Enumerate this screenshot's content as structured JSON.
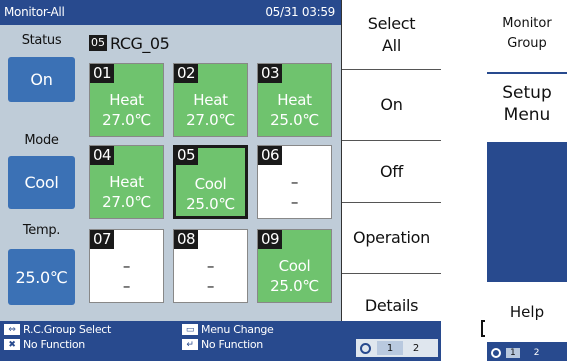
{
  "title_bar": {
    "left": "Monitor-All",
    "right": "05/31 03:59"
  },
  "left_column": {
    "status_label": "Status",
    "status_value": "On",
    "mode_label": "Mode",
    "mode_value": "Cool",
    "temp_label": "Temp.",
    "temp_value": "25.0℃"
  },
  "group": {
    "badge": "05",
    "name": "RCG_05"
  },
  "cells": [
    {
      "num": "01",
      "mode": "Heat",
      "temp": "27.0℃"
    },
    {
      "num": "02",
      "mode": "Heat",
      "temp": "27.0℃"
    },
    {
      "num": "03",
      "mode": "Heat",
      "temp": "25.0℃"
    },
    {
      "num": "04",
      "mode": "Heat",
      "temp": "27.0℃"
    },
    {
      "num": "05",
      "mode": "Cool",
      "temp": "25.0℃"
    },
    {
      "num": "06",
      "mode": "–",
      "temp": "–"
    },
    {
      "num": "07",
      "mode": "–",
      "temp": "–"
    },
    {
      "num": "08",
      "mode": "–",
      "temp": "–"
    },
    {
      "num": "09",
      "mode": "Cool",
      "temp": "25.0℃"
    }
  ],
  "soft_keys": {
    "select_all_line1": "Select",
    "select_all_line2": "All",
    "on": "On",
    "off": "Off",
    "operation": "Operation",
    "details": "Details"
  },
  "bottom_bar": {
    "hint1": "R.C.Group Select",
    "hint2": "Menu Change",
    "hint3": "No Function",
    "hint4": "No Function",
    "page1": "1",
    "page2": "2"
  },
  "side_panel": {
    "monitor_group_line1": "Monitor",
    "monitor_group_line2": "Group",
    "setup_menu_line1": "Setup",
    "setup_menu_line2": "Menu",
    "help": "Help",
    "page1": "1",
    "page2": "2"
  }
}
